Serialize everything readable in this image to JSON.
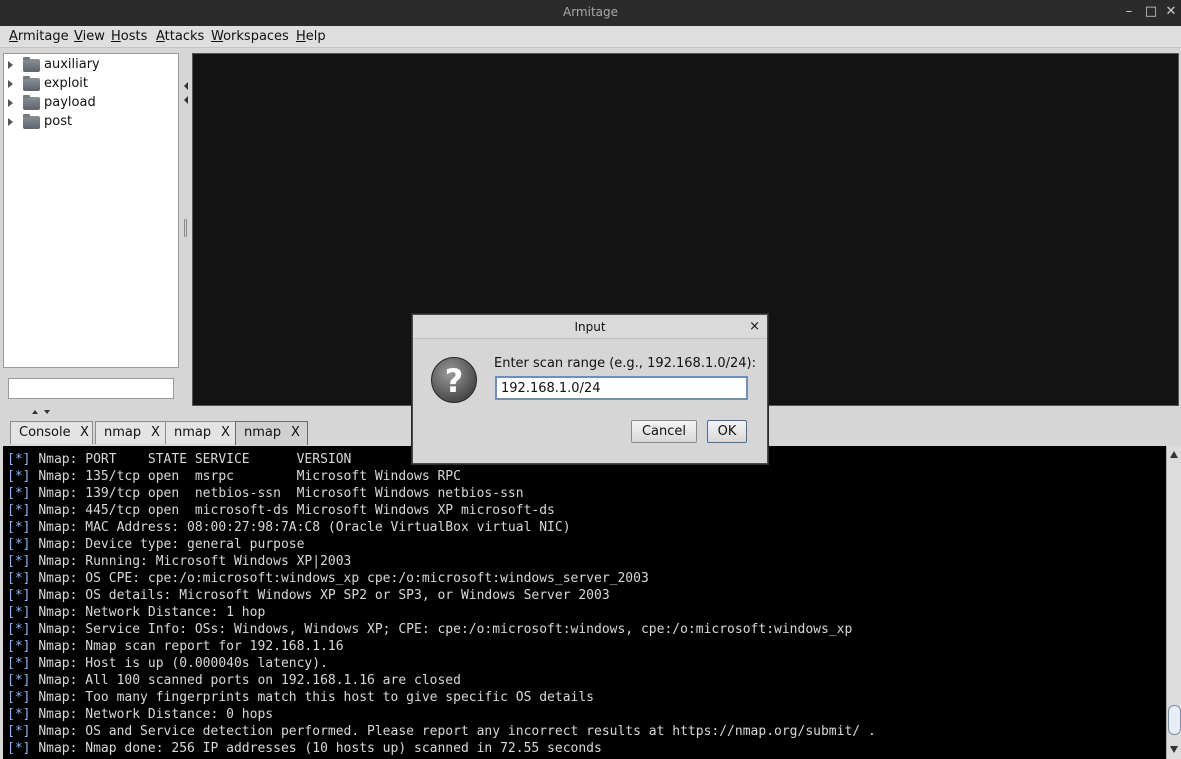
{
  "window": {
    "title": "Armitage"
  },
  "menu": [
    {
      "first": "A",
      "rest": "rmitage"
    },
    {
      "first": "V",
      "rest": "iew"
    },
    {
      "first": "H",
      "rest": "osts"
    },
    {
      "first": "A",
      "rest": "ttacks"
    },
    {
      "first": "W",
      "rest": "orkspaces"
    },
    {
      "first": "H",
      "rest": "elp"
    }
  ],
  "tree": [
    "auxiliary",
    "exploit",
    "payload",
    "post"
  ],
  "tabs": [
    {
      "label": "Console",
      "close": "X"
    },
    {
      "label": "nmap",
      "close": "X"
    },
    {
      "label": "nmap",
      "close": "X"
    },
    {
      "label": "nmap",
      "close": "X"
    }
  ],
  "console": {
    "prefix": "[*]",
    "lines": [
      "Nmap: PORT    STATE SERVICE      VERSION",
      "Nmap: 135/tcp open  msrpc        Microsoft Windows RPC",
      "Nmap: 139/tcp open  netbios-ssn  Microsoft Windows netbios-ssn",
      "Nmap: 445/tcp open  microsoft-ds Microsoft Windows XP microsoft-ds",
      "Nmap: MAC Address: 08:00:27:98:7A:C8 (Oracle VirtualBox virtual NIC)",
      "Nmap: Device type: general purpose",
      "Nmap: Running: Microsoft Windows XP|2003",
      "Nmap: OS CPE: cpe:/o:microsoft:windows_xp cpe:/o:microsoft:windows_server_2003",
      "Nmap: OS details: Microsoft Windows XP SP2 or SP3, or Windows Server 2003",
      "Nmap: Network Distance: 1 hop",
      "Nmap: Service Info: OSs: Windows, Windows XP; CPE: cpe:/o:microsoft:windows, cpe:/o:microsoft:windows_xp",
      "Nmap: Nmap scan report for 192.168.1.16",
      "Nmap: Host is up (0.000040s latency).",
      "Nmap: All 100 scanned ports on 192.168.1.16 are closed",
      "Nmap: Too many fingerprints match this host to give specific OS details",
      "Nmap: Network Distance: 0 hops",
      "Nmap: OS and Service detection performed. Please report any incorrect results at https://nmap.org/submit/ .",
      "Nmap: Nmap done: 256 IP addresses (10 hosts up) scanned in 72.55 seconds"
    ]
  },
  "dialog": {
    "title": "Input",
    "close": "×",
    "icon": "?",
    "prompt": "Enter scan range (e.g., 192.168.1.0/24):",
    "value": "192.168.1.0/24",
    "cancel": "Cancel",
    "ok": "OK"
  }
}
